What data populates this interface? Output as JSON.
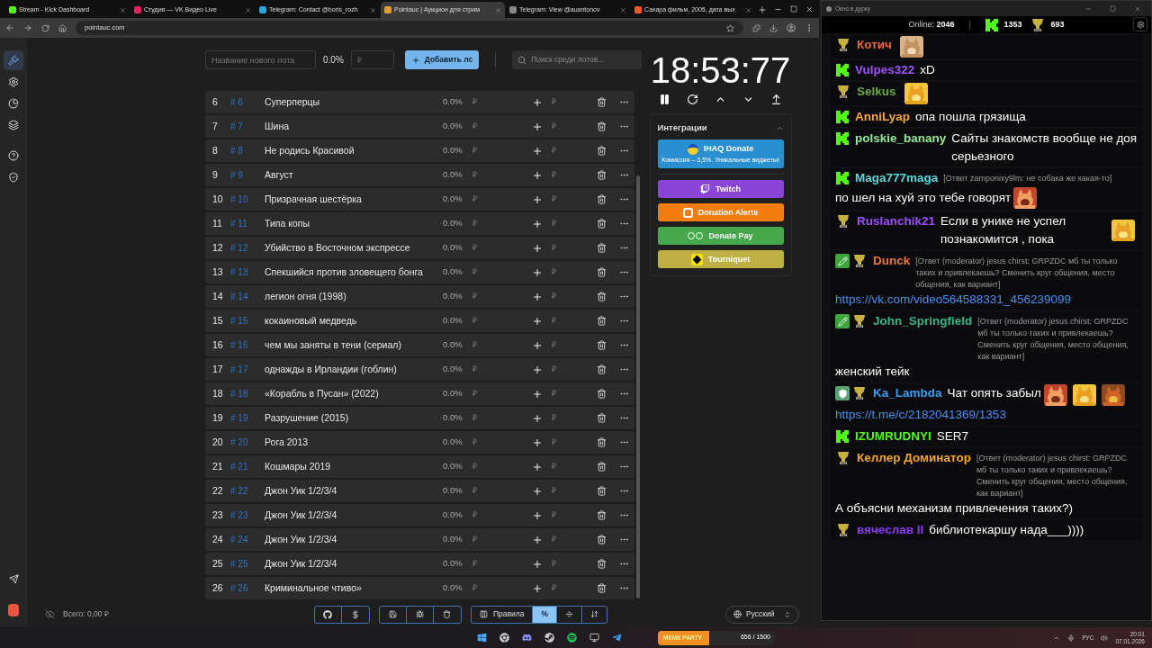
{
  "browser": {
    "tabs": [
      {
        "title": "Stream - Kick Dashboard",
        "selected": false,
        "color": "#53fc18"
      },
      {
        "title": "Студия — VK Видео Live",
        "selected": false,
        "color": "#e0245e"
      },
      {
        "title": "Telegram: Contact @boris_rozh",
        "selected": false,
        "color": "#2aa3df"
      },
      {
        "title": "Pointauc | Аукцион для стрим",
        "selected": true,
        "color": "#e0a030"
      },
      {
        "title": "Telegram: View @auantonov",
        "selected": false,
        "color": "#888888"
      },
      {
        "title": "Сахара фильм, 2005, дата вых",
        "selected": false,
        "color": "#f05a22"
      }
    ],
    "url": "pointauc.com"
  },
  "sidebar_items": [
    {
      "selected": true
    },
    {
      "selected": false
    },
    {
      "selected": false
    },
    {
      "selected": false
    },
    {
      "selected": false
    },
    {
      "selected": false
    }
  ],
  "new_lot": {
    "name_placeholder": "Название нового лота",
    "percent": "0.0%",
    "amount_placeholder": "₽",
    "add_button": "Добавить лс",
    "search_placeholder": "Поиск среди лотов..."
  },
  "lots": [
    {
      "index": "6",
      "id": "# 6",
      "name": "Суперперцы",
      "percent": "0.0%",
      "amount": "₽",
      "add_amount": "₽"
    },
    {
      "index": "7",
      "id": "# 7",
      "name": "Шина",
      "percent": "0.0%",
      "amount": "₽",
      "add_amount": "₽"
    },
    {
      "index": "8",
      "id": "# 8",
      "name": "Не родись Красивой",
      "percent": "0.0%",
      "amount": "₽",
      "add_amount": "₽"
    },
    {
      "index": "9",
      "id": "# 9",
      "name": "Август",
      "percent": "0.0%",
      "amount": "₽",
      "add_amount": "₽"
    },
    {
      "index": "10",
      "id": "# 10",
      "name": "Призрачная шестёрка",
      "percent": "0.0%",
      "amount": "₽",
      "add_amount": "₽"
    },
    {
      "index": "11",
      "id": "# 11",
      "name": "Типа копы",
      "percent": "0.0%",
      "amount": "₽",
      "add_amount": "₽"
    },
    {
      "index": "12",
      "id": "# 12",
      "name": "Убийство в Восточном экспрессе",
      "percent": "0.0%",
      "amount": "₽",
      "add_amount": "₽"
    },
    {
      "index": "13",
      "id": "# 13",
      "name": "Спекшийся против зловещего бонга",
      "percent": "0.0%",
      "amount": "₽",
      "add_amount": "₽"
    },
    {
      "index": "14",
      "id": "# 14",
      "name": "легион огня (1998)",
      "percent": "0.0%",
      "amount": "₽",
      "add_amount": "₽"
    },
    {
      "index": "15",
      "id": "# 15",
      "name": "кокаиновый медведь",
      "percent": "0.0%",
      "amount": "₽",
      "add_amount": "₽"
    },
    {
      "index": "16",
      "id": "# 16",
      "name": "чем мы заняты в тени (сериал)",
      "percent": "0.0%",
      "amount": "₽",
      "add_amount": "₽"
    },
    {
      "index": "17",
      "id": "# 17",
      "name": "однажды в Ирландии (гоблин)",
      "percent": "0.0%",
      "amount": "₽",
      "add_amount": "₽"
    },
    {
      "index": "18",
      "id": "# 18",
      "name": "«Корабль в Пусан» (2022)",
      "percent": "0.0%",
      "amount": "₽",
      "add_amount": "₽"
    },
    {
      "index": "19",
      "id": "# 19",
      "name": "Разрушение (2015)",
      "percent": "0.0%",
      "amount": "₽",
      "add_amount": "₽"
    },
    {
      "index": "20",
      "id": "# 20",
      "name": "Рога 2013",
      "percent": "0.0%",
      "amount": "₽",
      "add_amount": "₽"
    },
    {
      "index": "21",
      "id": "# 21",
      "name": "Кошмары 2019",
      "percent": "0.0%",
      "amount": "₽",
      "add_amount": "₽"
    },
    {
      "index": "22",
      "id": "# 22",
      "name": "Джон Уик 1/2/3/4",
      "percent": "0.0%",
      "amount": "₽",
      "add_amount": "₽"
    },
    {
      "index": "23",
      "id": "# 23",
      "name": "Джон Уик 1/2/3/4",
      "percent": "0.0%",
      "amount": "₽",
      "add_amount": "₽"
    },
    {
      "index": "24",
      "id": "# 24",
      "name": "Джон Уик 1/2/3/4",
      "percent": "0.0%",
      "amount": "₽",
      "add_amount": "₽"
    },
    {
      "index": "25",
      "id": "# 25",
      "name": "Джон Уик 1/2/3/4",
      "percent": "0.0%",
      "amount": "₽",
      "add_amount": "₽"
    },
    {
      "index": "26",
      "id": "# 26",
      "name": "Криминальное чтиво»",
      "percent": "0.0%",
      "amount": "₽",
      "add_amount": "₽"
    }
  ],
  "timer": "18:53:77",
  "integrations": {
    "title": "Интеграции",
    "expanded": true,
    "items": [
      {
        "kind": "ihaq",
        "label": "IHAQ Donate",
        "subtitle": "Комиссия – 3,5%. Уникальные виджеты!",
        "color": "#2a8fd0"
      },
      {
        "kind": "twitch",
        "label": "Twitch",
        "color": "#8a45d6"
      },
      {
        "kind": "donationalerts",
        "label": "Donation Alerts",
        "color": "#f57d0f"
      },
      {
        "kind": "donatepay",
        "label": "Donate Pay",
        "color": "#45a84a"
      },
      {
        "kind": "tourniquet",
        "label": "Tourniquet",
        "color": "#bfb044"
      }
    ]
  },
  "footer": {
    "total": "Всего: 0,00 ₽",
    "view_buttons": [
      {
        "label": "Правила",
        "selected": false
      },
      {
        "label": "%",
        "selected": true
      },
      {
        "selected": false
      },
      {
        "selected": false
      }
    ],
    "language": "Русский"
  },
  "chat": {
    "title": "Окно в дурку",
    "online_label": "Online:",
    "online": "2046",
    "kick_count": "1353",
    "trophy_count": "693",
    "messages": [
      {
        "badges": [
          {
            "kind": "trophy"
          }
        ],
        "user": "Котич",
        "color": "#e8663c",
        "emotes": [
          {
            "kind": "picture"
          }
        ]
      },
      {
        "badges": [
          {
            "kind": "kick"
          }
        ],
        "user": "Vulpes322",
        "color": "#9f55ff",
        "text": "xD"
      },
      {
        "badges": [
          {
            "kind": "trophy"
          }
        ],
        "user": "Selkus",
        "color": "#6aaa44",
        "emotes": [
          {
            "kind": "picture"
          }
        ]
      },
      {
        "badges": [
          {
            "kind": "kick"
          }
        ],
        "user": "AnniLyap",
        "color": "#f5a83a",
        "text": "опа пошла грязища"
      },
      {
        "badges": [
          {
            "kind": "kick"
          }
        ],
        "user": "polskie_banany",
        "color": "#98e89a",
        "text": "Сайты знакомств вообще не доя серьезного"
      },
      {
        "badges": [
          {
            "kind": "kick"
          }
        ],
        "user": "Maga777maga",
        "color": "#5fd6dc",
        "reply": "[Ответ zamponixy9lm: не собака же какая-то]",
        "text": "по шел на хуй это тебе говорят",
        "emotes": [
          {
            "kind": "picture"
          }
        ]
      },
      {
        "badges": [
          {
            "kind": "trophy"
          }
        ],
        "user": "Ruslanchik21",
        "color": "#a14dff",
        "text": "Если в унике не успел познакомится , пока",
        "emotes": [
          {
            "kind": "picture"
          }
        ]
      },
      {
        "badges": [
          {
            "kind": "moderator"
          },
          {
            "kind": "trophy"
          }
        ],
        "user": "Dunck",
        "color": "#e8773c",
        "reply": "[Ответ (moderator) jesus chirst: GRPZDC  мб ты только таких и привлекаешь? Сменить круг общения, место общения, как вариант]",
        "link": "https://vk.com/video564588331_456239099"
      },
      {
        "badges": [
          {
            "kind": "moderator"
          },
          {
            "kind": "trophy"
          }
        ],
        "user": "John_Springfield",
        "color": "#34b58a",
        "reply": "[Ответ (moderator) jesus chirst: GRPZDC  мб ты только таких и привлекаешь? Сменить круг общения, место общения, как вариант]",
        "text": "женский тейк"
      },
      {
        "badges": [
          {
            "kind": "vip"
          },
          {
            "kind": "trophy"
          }
        ],
        "user": "Ka_Lambda",
        "color": "#3d9cf0",
        "text": "Чат опять забыл",
        "emotes": [
          {
            "kind": "picture"
          },
          {
            "kind": "picture"
          },
          {
            "kind": "picture"
          }
        ],
        "link": "https://t.me/c/2182041369/1353"
      },
      {
        "badges": [
          {
            "kind": "kick"
          }
        ],
        "user": "IZUMRUDNYI",
        "color": "#53fc18",
        "text": "SER7"
      },
      {
        "badges": [
          {
            "kind": "trophy"
          }
        ],
        "user": "Келлер Доминатор",
        "color": "#f5a524",
        "reply": "[Ответ (moderator) jesus chirst: GRPZDC  мб ты только таких и привлекаешь? Сменить круг общения, место общения, как вариант]",
        "text": "А объясни механизм привлечения таких?)"
      },
      {
        "badges": [
          {
            "kind": "trophy"
          }
        ],
        "user": "вячеслав II",
        "color": "#8a3df0",
        "text": "библиотекаршу нада___))))"
      }
    ]
  },
  "taskbar": {
    "widget_title": "MEME PARTY",
    "widget_count": "656 / 1500",
    "level": 0.437,
    "language": "РУС",
    "time": "20:01",
    "date": "07.01.2026"
  }
}
